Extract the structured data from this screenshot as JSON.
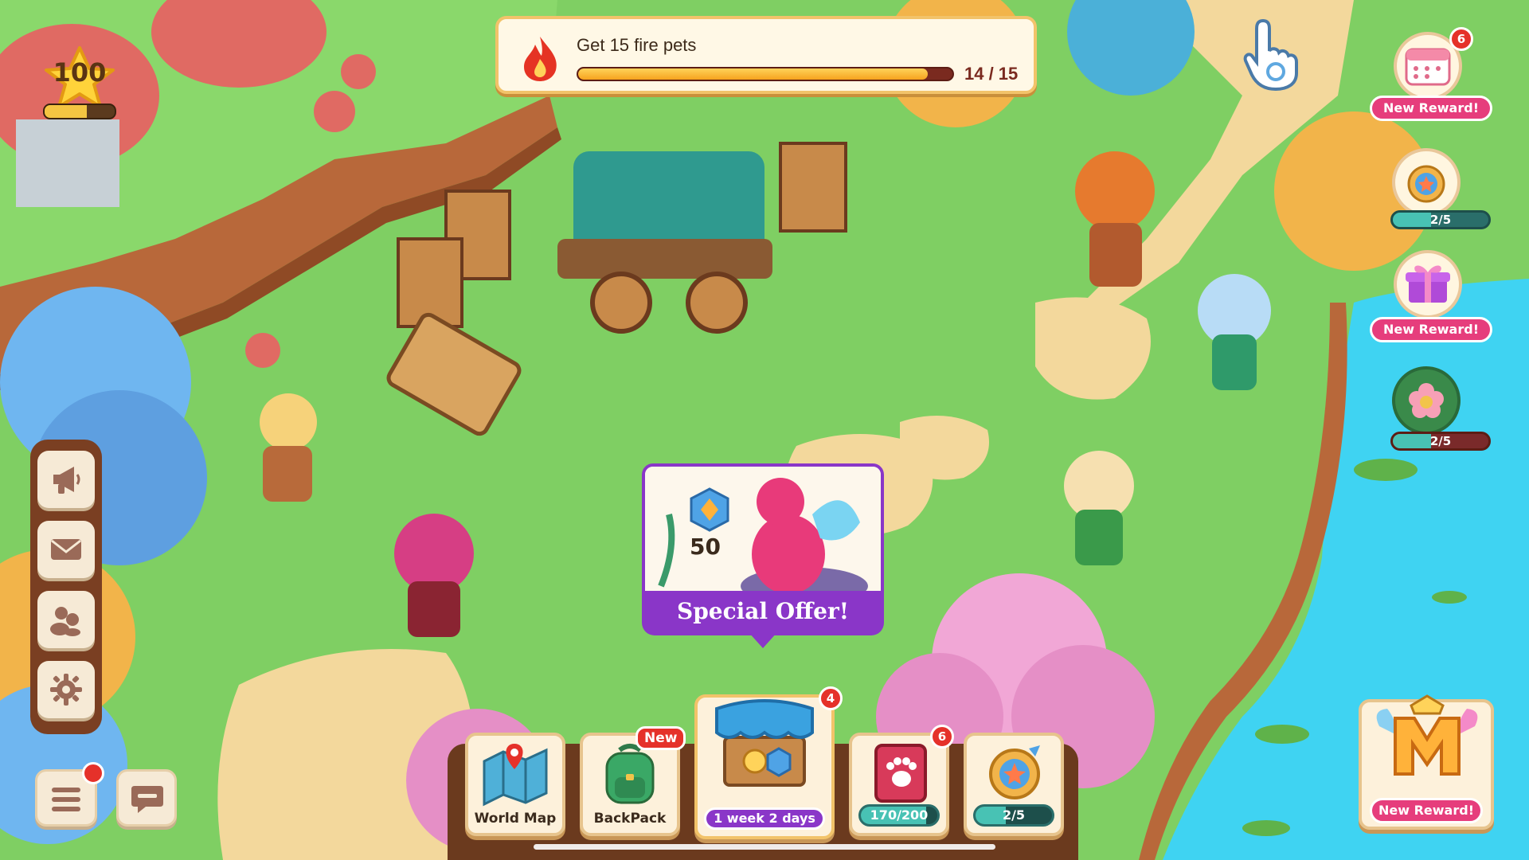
{
  "quest": {
    "text": "Get 15 fire pets",
    "current": 14,
    "total": 15,
    "count_label": "14 / 15",
    "icon": "fire-icon"
  },
  "player": {
    "level": "100",
    "xp_fraction": 0.6,
    "icon": "star-icon"
  },
  "right_rewards": [
    {
      "name": "calendar-reward",
      "icon": "calendar-icon",
      "badge": "6",
      "label": "New Reward!"
    },
    {
      "name": "pet-ring-reward",
      "icon": "pet-ring-icon",
      "progress_label": "2/5",
      "progress": 0.4
    },
    {
      "name": "gift-reward",
      "icon": "gift-icon",
      "label": "New Reward!"
    },
    {
      "name": "flower-reward",
      "icon": "flower-icon",
      "progress_label": "2/5",
      "progress": 0.4
    }
  ],
  "left_menu": [
    {
      "name": "announcements",
      "icon": "megaphone-icon"
    },
    {
      "name": "mail",
      "icon": "envelope-icon"
    },
    {
      "name": "friends",
      "icon": "friends-icon"
    },
    {
      "name": "settings",
      "icon": "gear-icon"
    }
  ],
  "special_offer": {
    "label": "Special Offer!",
    "cost": "50",
    "currency_icon": "gem-icon"
  },
  "dock": {
    "world_map": {
      "label": "World Map",
      "icon": "map-icon"
    },
    "backpack": {
      "label": "BackPack",
      "tag": "New",
      "icon": "backpack-icon"
    },
    "shop": {
      "timer": "1 week 2 days",
      "badge": "4",
      "icon": "shop-icon"
    },
    "pet_book": {
      "progress_label": "170/200",
      "progress": 0.85,
      "badge": "6",
      "icon": "paw-book-icon"
    },
    "pet_ring": {
      "progress_label": "2/5",
      "progress": 0.4,
      "icon": "pet-ring-icon"
    }
  },
  "membership": {
    "label": "New Reward!",
    "icon": "membership-m-icon"
  },
  "colors": {
    "grass": "#7fcf63",
    "offer_purple": "#8a36c8",
    "reward_pink": "#e63d7c",
    "badge_red": "#e5312a",
    "progress_teal": "#48c2b4",
    "water": "#3fd3f2"
  }
}
